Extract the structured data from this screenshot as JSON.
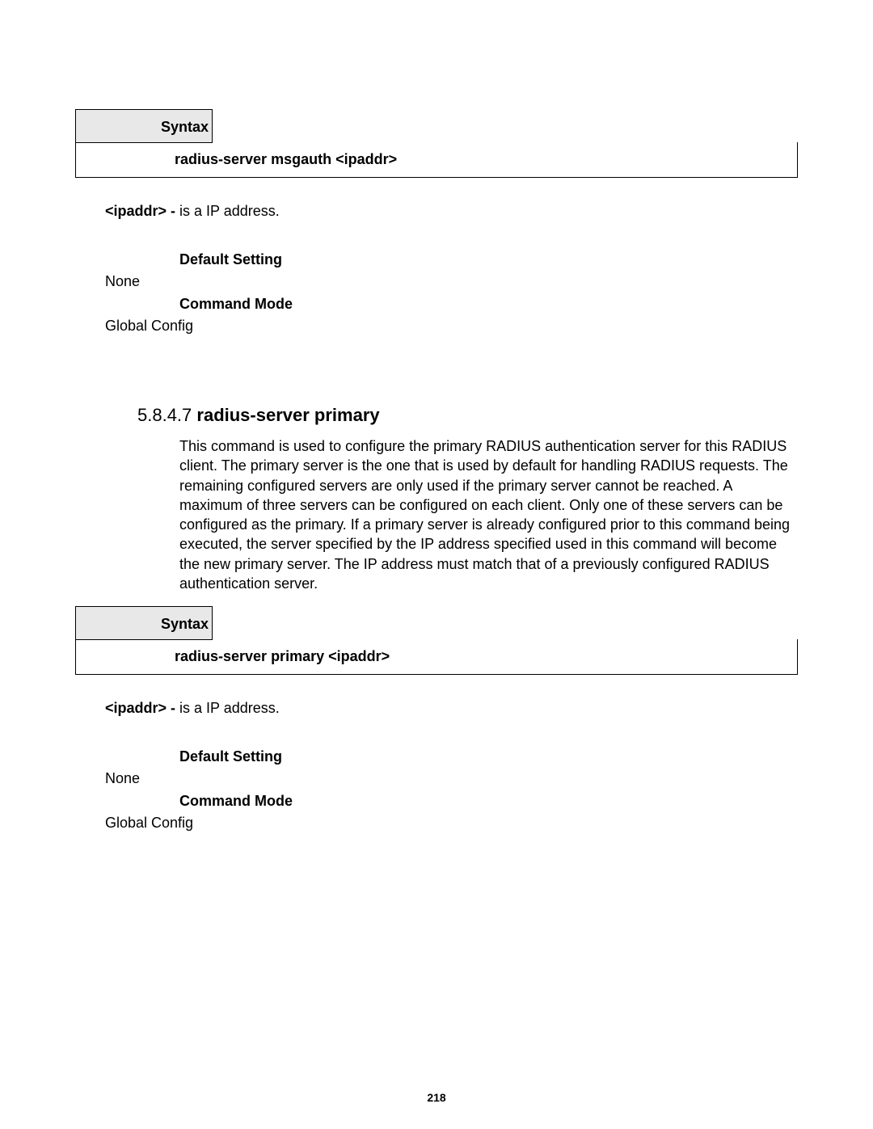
{
  "syntax_label": "Syntax",
  "section1": {
    "syntax_cmd": "radius-server msgauth <ipaddr>",
    "param_name": "<ipaddr> - ",
    "param_desc": "is a IP address.",
    "default_setting_label": "Default Setting",
    "default_setting_value": "None",
    "command_mode_label": "Command Mode",
    "command_mode_value": "Global Config"
  },
  "section2": {
    "number": "5.8.4.7",
    "title": " radius-server primary",
    "body": "This command is used to configure the primary RADIUS authentication server for this RADIUS client. The primary server is the one that is used by default for handling RADIUS requests. The remaining configured servers are only used if the primary server cannot be reached. A maximum of three servers can be configured on each client. Only one of these servers can be configured as the primary. If a primary server is already configured prior to this command being executed, the server specified by the IP address specified used in this command will become the new primary server. The IP address must match that of a previously configured RADIUS authentication server.",
    "syntax_cmd": "radius-server primary <ipaddr>",
    "param_name": "<ipaddr> - ",
    "param_desc": "is a IP address.",
    "default_setting_label": "Default Setting",
    "default_setting_value": "None",
    "command_mode_label": "Command Mode",
    "command_mode_value": "Global Config"
  },
  "page_number": "218"
}
